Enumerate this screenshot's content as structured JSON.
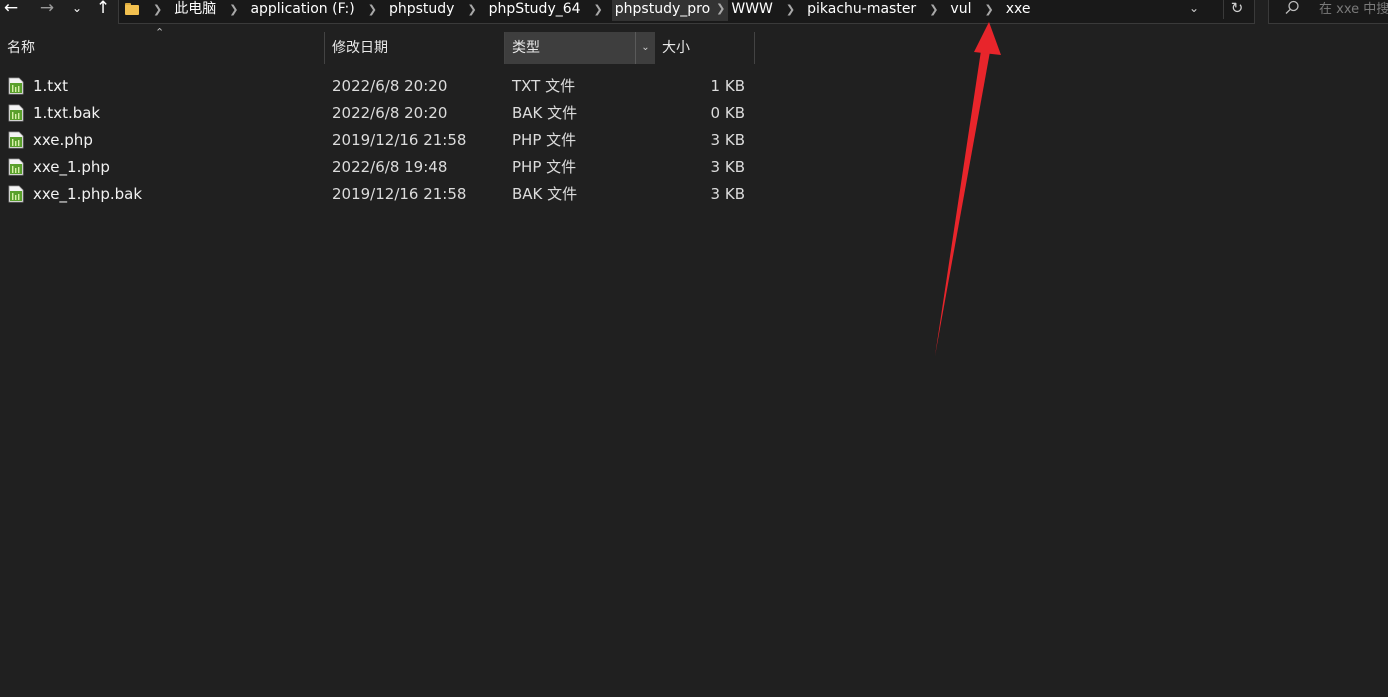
{
  "nav": {
    "back_icon": "arrow-left-icon",
    "forward_icon": "arrow-right-icon",
    "recent_icon": "chevron-down-icon",
    "up_icon": "arrow-up-icon"
  },
  "breadcrumb": [
    "此电脑",
    "application (F:)",
    "phpstudy",
    "phpStudy_64",
    "phpstudy_pro",
    "WWW",
    "pikachu-master",
    "vul",
    "xxe"
  ],
  "search": {
    "placeholder": "在 xxe 中搜"
  },
  "columns": {
    "name": "名称",
    "date": "修改日期",
    "type": "类型",
    "size": "大小"
  },
  "files": [
    {
      "name": "1.txt",
      "date": "2022/6/8 20:20",
      "type": "TXT 文件",
      "size": "1 KB"
    },
    {
      "name": "1.txt.bak",
      "date": "2022/6/8 20:20",
      "type": "BAK 文件",
      "size": "0 KB"
    },
    {
      "name": "xxe.php",
      "date": "2019/12/16 21:58",
      "type": "PHP 文件",
      "size": "3 KB"
    },
    {
      "name": "xxe_1.php",
      "date": "2022/6/8 19:48",
      "type": "PHP 文件",
      "size": "3 KB"
    },
    {
      "name": "xxe_1.php.bak",
      "date": "2019/12/16 21:58",
      "type": "BAK 文件",
      "size": "3 KB"
    }
  ],
  "colors": {
    "background": "#202020",
    "header_active": "#3e3e3e",
    "annotation_arrow": "#e8252b",
    "file_icon_green": "#5aa02c"
  }
}
